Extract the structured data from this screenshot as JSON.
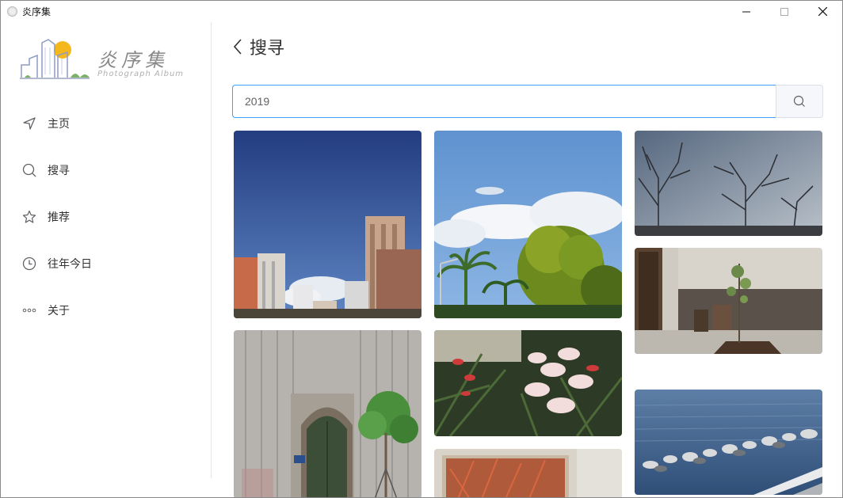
{
  "window": {
    "title": "炎序集"
  },
  "logo": {
    "text_cn": "炎序集",
    "text_en": "Photograph Album"
  },
  "sidebar": {
    "items": [
      {
        "label": "主页",
        "icon": "navigate-icon"
      },
      {
        "label": "搜寻",
        "icon": "search-icon"
      },
      {
        "label": "推荐",
        "icon": "star-icon"
      },
      {
        "label": "往年今日",
        "icon": "clock-icon"
      },
      {
        "label": "关于",
        "icon": "more-dots-icon"
      }
    ]
  },
  "main": {
    "title": "搜寻",
    "search": {
      "value": "2019",
      "placeholder": ""
    }
  },
  "photos": [
    {
      "name": "photo-city-buildings"
    },
    {
      "name": "photo-palm-trees-sky"
    },
    {
      "name": "photo-bare-branches"
    },
    {
      "name": "photo-courtyard-tree"
    },
    {
      "name": "photo-old-doorway"
    },
    {
      "name": "photo-pink-lilies"
    },
    {
      "name": "photo-red-flowers"
    },
    {
      "name": "photo-lake-shore"
    }
  ],
  "colors": {
    "accent": "#409eff",
    "text": "#303133"
  }
}
